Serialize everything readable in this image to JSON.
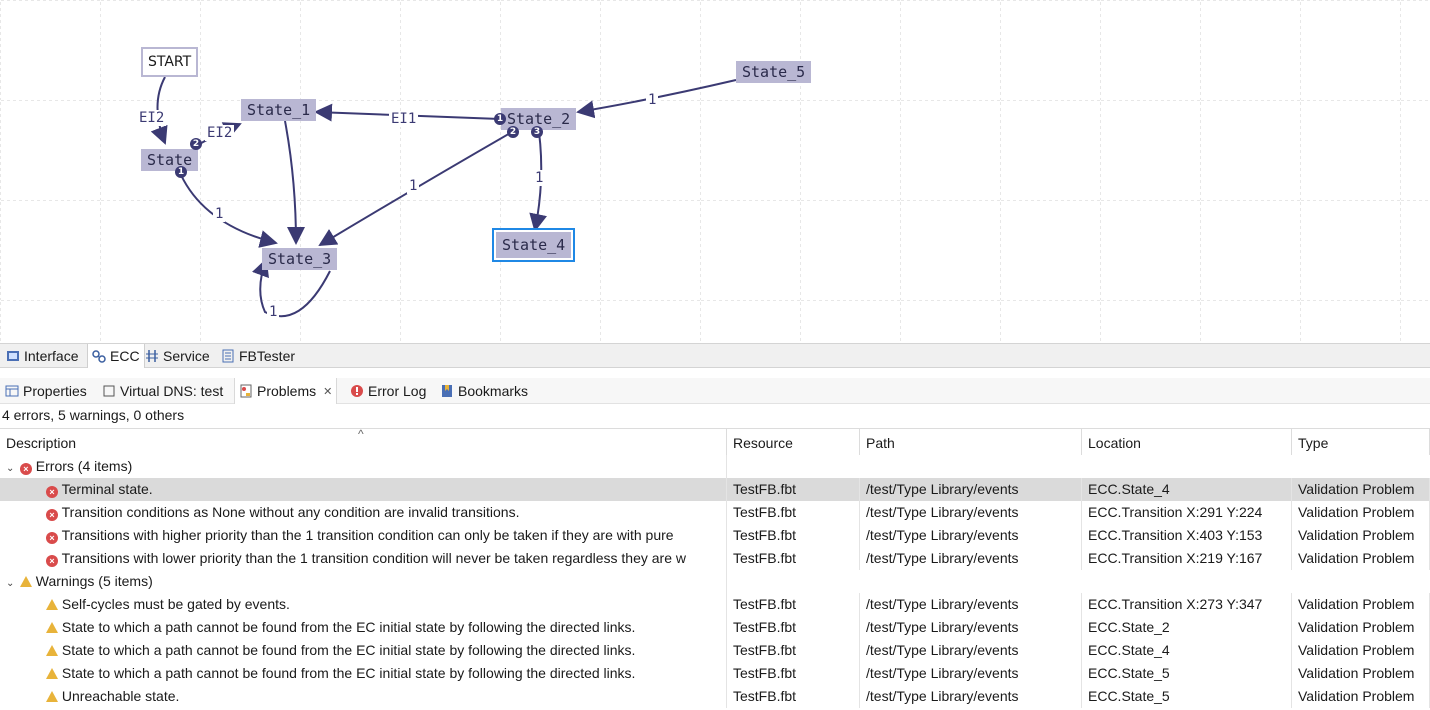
{
  "ecc": {
    "states": {
      "start": "START",
      "state": "State",
      "state1": "State_1",
      "state2": "State_2",
      "state3": "State_3",
      "state4": "State_4",
      "state5": "State_5"
    },
    "transitions": {
      "start_state": "EI2",
      "state_state1": "EI2",
      "state2_state1": "EI1",
      "state5_state2": "1",
      "state_state3": "1",
      "state2_state3": "1",
      "state2_state4": "1",
      "state3_self": "1"
    },
    "priorities": {
      "state_p2": "2",
      "state_p1": "1",
      "state2_p1": "1",
      "state2_p2": "2",
      "state2_p3": "3"
    }
  },
  "editor_tabs": [
    "Interface",
    "ECC",
    "Service",
    "FBTester"
  ],
  "view_tabs": [
    "Properties",
    "Virtual DNS: test",
    "Problems",
    "Error Log",
    "Bookmarks"
  ],
  "problems": {
    "summary": "4 errors, 5 warnings, 0 others",
    "sort_indicator": "^",
    "columns": [
      "Description",
      "Resource",
      "Path",
      "Location",
      "Type"
    ],
    "groups": [
      {
        "label": "Errors (4 items)",
        "kind": "error",
        "items": [
          {
            "description": "Terminal state.",
            "resource": "TestFB.fbt",
            "path": "/test/Type Library/events",
            "location": "ECC.State_4",
            "type": "Validation Problem"
          },
          {
            "description": "Transition conditions as None without any condition are invalid transitions.",
            "resource": "TestFB.fbt",
            "path": "/test/Type Library/events",
            "location": "ECC.Transition X:291 Y:224",
            "type": "Validation Problem"
          },
          {
            "description": "Transitions with higher priority than the 1 transition condition can only be taken if they are with pure",
            "resource": "TestFB.fbt",
            "path": "/test/Type Library/events",
            "location": "ECC.Transition X:403 Y:153",
            "type": "Validation Problem"
          },
          {
            "description": "Transitions with lower priority than the 1 transition condition will never be taken regardless they are w",
            "resource": "TestFB.fbt",
            "path": "/test/Type Library/events",
            "location": "ECC.Transition X:219 Y:167",
            "type": "Validation Problem"
          }
        ]
      },
      {
        "label": "Warnings (5 items)",
        "kind": "warning",
        "items": [
          {
            "description": "Self-cycles must be gated by events.",
            "resource": "TestFB.fbt",
            "path": "/test/Type Library/events",
            "location": "ECC.Transition X:273 Y:347",
            "type": "Validation Problem"
          },
          {
            "description": "State to which a path cannot be found from the EC initial state by following the directed links.",
            "resource": "TestFB.fbt",
            "path": "/test/Type Library/events",
            "location": "ECC.State_2",
            "type": "Validation Problem"
          },
          {
            "description": "State to which a path cannot be found from the EC initial state by following the directed links.",
            "resource": "TestFB.fbt",
            "path": "/test/Type Library/events",
            "location": "ECC.State_4",
            "type": "Validation Problem"
          },
          {
            "description": "State to which a path cannot be found from the EC initial state by following the directed links.",
            "resource": "TestFB.fbt",
            "path": "/test/Type Library/events",
            "location": "ECC.State_5",
            "type": "Validation Problem"
          },
          {
            "description": "Unreachable state.",
            "resource": "TestFB.fbt",
            "path": "/test/Type Library/events",
            "location": "ECC.State_5",
            "type": "Validation Problem"
          }
        ]
      }
    ]
  },
  "colors": {
    "state_fill": "#b9b7d3",
    "transition": "#3b3a73",
    "selection": "#1f88e5",
    "error": "#d94b4b",
    "warning": "#e8b33a",
    "selected_row": "#dadada"
  }
}
